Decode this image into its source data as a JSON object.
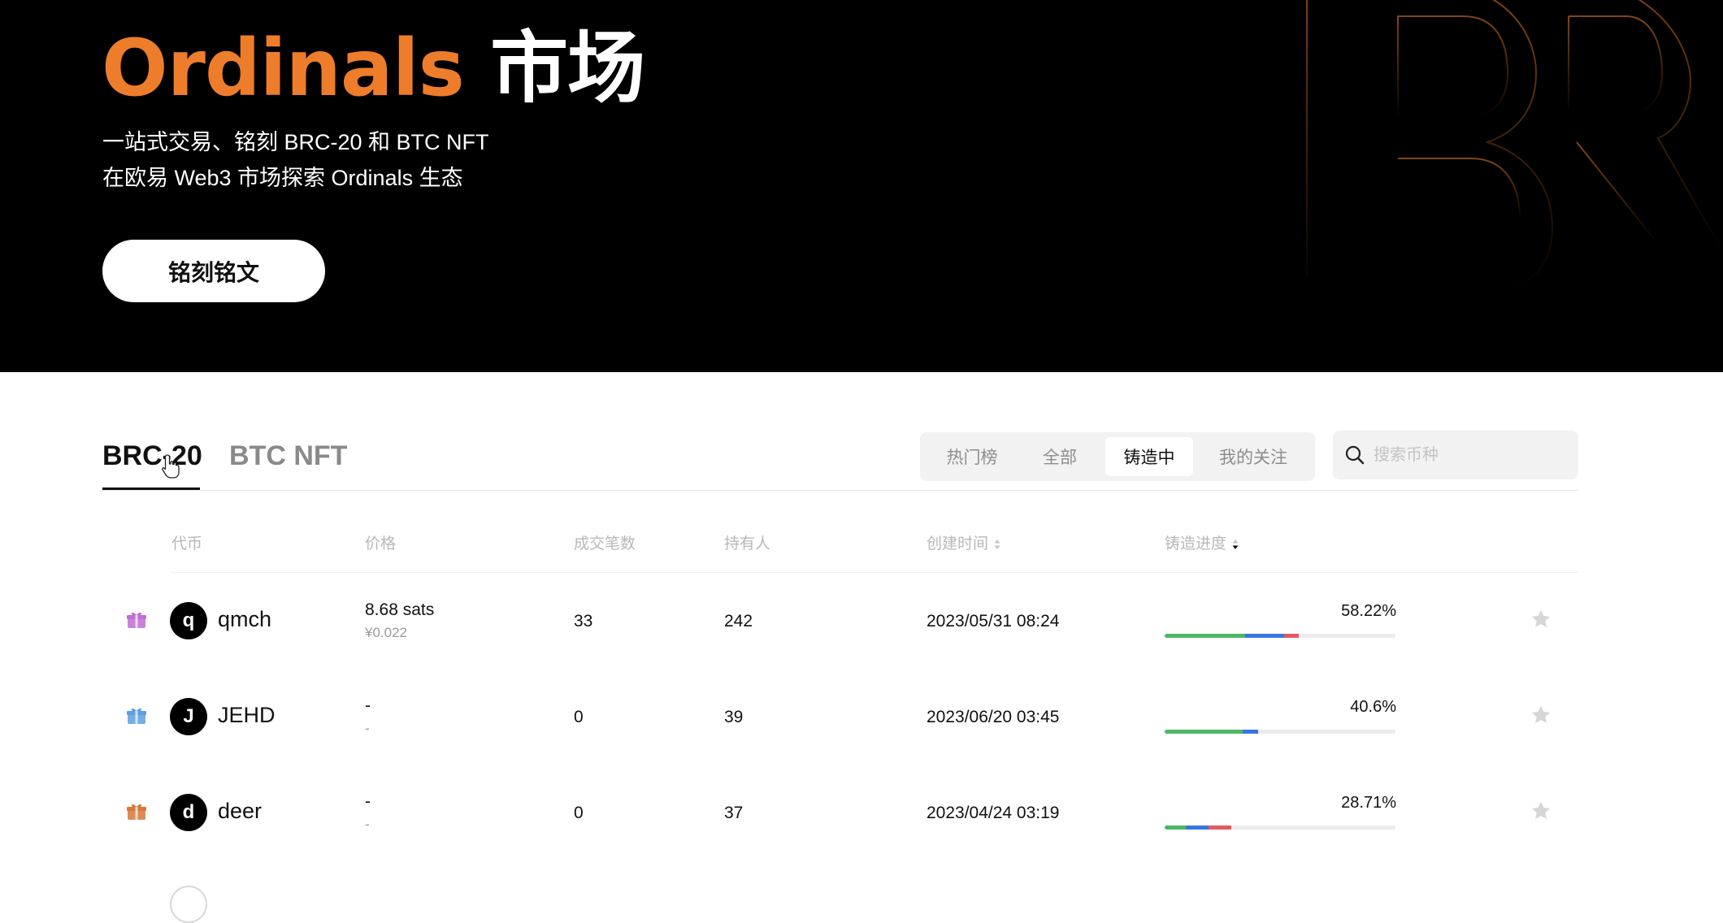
{
  "hero": {
    "title_brand": "Ordinals",
    "title_rest": "市场",
    "subtitle_line1": "一站式交易、铭刻 BRC-20 和 BTC NFT",
    "subtitle_line2": "在欧易 Web3 市场探索 Ordinals 生态",
    "cta_label": "铭刻铭文",
    "brand_color": "#ee7d2b"
  },
  "tabs": [
    {
      "label": "BRC-20",
      "active": true
    },
    {
      "label": "BTC NFT",
      "active": false
    }
  ],
  "filters": [
    {
      "label": "热门榜",
      "active": false
    },
    {
      "label": "全部",
      "active": false
    },
    {
      "label": "铸造中",
      "active": true
    },
    {
      "label": "我的关注",
      "active": false
    }
  ],
  "search": {
    "placeholder": "搜索币种",
    "value": ""
  },
  "table": {
    "headers": {
      "token": "代币",
      "price": "价格",
      "trades": "成交笔数",
      "holders": "持有人",
      "created": "创建时间",
      "progress": "铸造进度"
    },
    "rows": [
      {
        "avatar_letter": "q",
        "name": "qmch",
        "price": "8.68 sats",
        "price_cny": "¥0.022",
        "trades": "33",
        "holders": "242",
        "created": "2023/05/31 08:24",
        "progress_label": "58.22%",
        "progress": 0.5822,
        "segments": [
          {
            "color": "#4cb866",
            "frac": 0.35
          },
          {
            "color": "#3b76e0",
            "frac": 0.17
          },
          {
            "color": "#e25a63",
            "frac": 0.0622
          }
        ],
        "badge_color": "#c06cd6",
        "badge_icon": "gift-icon"
      },
      {
        "avatar_letter": "J",
        "name": "JEHD",
        "price": "-",
        "price_cny": "-",
        "trades": "0",
        "holders": "39",
        "created": "2023/06/20 03:45",
        "progress_label": "40.6%",
        "progress": 0.406,
        "segments": [
          {
            "color": "#4cb866",
            "frac": 0.34
          },
          {
            "color": "#3b76e0",
            "frac": 0.066
          }
        ],
        "badge_color": "#5aa0e0",
        "badge_icon": "gift-icon"
      },
      {
        "avatar_letter": "d",
        "name": "deer",
        "price": "-",
        "price_cny": "-",
        "trades": "0",
        "holders": "37",
        "created": "2023/04/24 03:19",
        "progress_label": "28.71%",
        "progress": 0.2871,
        "segments": [
          {
            "color": "#4cb866",
            "frac": 0.09
          },
          {
            "color": "#3b76e0",
            "frac": 0.1
          },
          {
            "color": "#e25a63",
            "frac": 0.0971
          }
        ],
        "badge_color": "#d9783a",
        "badge_icon": "gift-icon"
      }
    ]
  }
}
